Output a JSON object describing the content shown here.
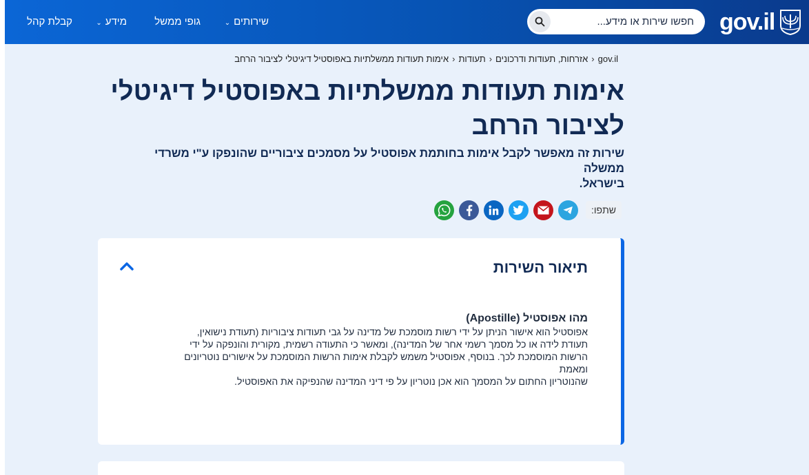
{
  "header": {
    "logo_text": "gov.il",
    "search": {
      "placeholder": "חפשו שירות או מידע..."
    },
    "nav": [
      {
        "label": "שירותים",
        "has_dropdown": true
      },
      {
        "label": "גופי ממשל",
        "has_dropdown": false
      },
      {
        "label": "מידע",
        "has_dropdown": true
      },
      {
        "label": "קבלת קהל",
        "has_dropdown": false
      }
    ]
  },
  "breadcrumb": [
    "gov.il",
    "אזרחות, תעודות ודרכונים",
    "תעודות",
    "אימות תעודות ממשלתיות באפוסטיל דיגיטלי לציבור הרחב"
  ],
  "page": {
    "title_line1": "אימות תעודות ממשלתיות באפוסטיל דיגיטלי",
    "title_line2": "לציבור הרחב",
    "subtitle_line1": "שירות זה מאפשר לקבל אימות בחותמת אפוסטיל על מסמכים ציבוריים שהונפקו ע\"י משרדי ממשלה",
    "subtitle_line2": "בישראל."
  },
  "share": {
    "label": "שתפו:",
    "buttons": [
      {
        "name": "telegram",
        "color": "#2ca5e0"
      },
      {
        "name": "email",
        "color": "#c4151c"
      },
      {
        "name": "twitter",
        "color": "#1da1f2"
      },
      {
        "name": "linkedin",
        "color": "#0a66c2"
      },
      {
        "name": "facebook",
        "color": "#3b5998"
      },
      {
        "name": "whatsapp",
        "color": "#25a33f"
      }
    ]
  },
  "service_card": {
    "title": "תיאור השירות",
    "expanded": true,
    "heading": "מהו אפוסטיל (Apostille)",
    "lines": [
      "אפוסטיל הוא אישור הניתן על ידי רשות מוסמכת של מדינה על גבי תעודות ציבוריות (תעודת נישואין,",
      "תעודת לידה או כל מסמך רשמי אחר של המדינה), ומאשר כי התעודה רשמית, מקורית והונפקה על ידי",
      "הרשות המוסמכת לכך. בנוסף, אפוסטיל משמש לקבלת אימות הרשות המוסמכת על אישורים נוטריונים",
      "ומאמת",
      "שהנוטריון החתום על המסמך הוא אכן נוטריון על פי דיני המדינה שהנפיקה את האפוסטיל."
    ]
  },
  "colors": {
    "header_start": "#0b66d6",
    "header_end": "#0a3a8c",
    "title": "#112a54",
    "accent": "#0b66e4",
    "background": "#e9f1fb"
  }
}
